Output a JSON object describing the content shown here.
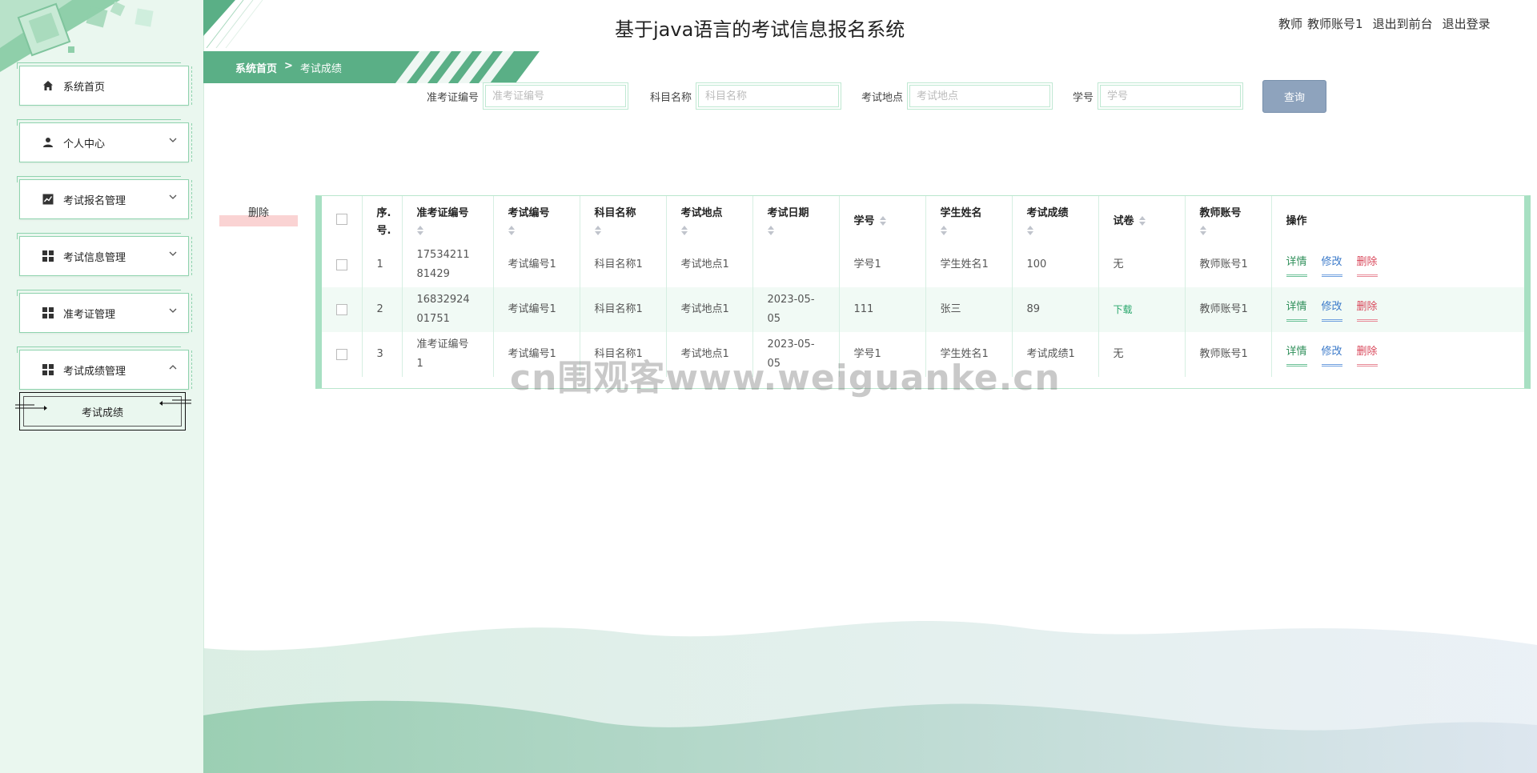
{
  "app": {
    "title": "基于java语言的考试信息报名系统"
  },
  "user_bar": {
    "role": "教师",
    "account": "教师账号1",
    "to_front": "退出到前台",
    "logout": "退出登录"
  },
  "breadcrumb": {
    "home": "系统首页",
    "sep": ">",
    "current": "考试成绩"
  },
  "sidebar": {
    "items": [
      {
        "label": "系统首页",
        "icon": "home-icon"
      },
      {
        "label": "个人中心",
        "icon": "user-icon"
      },
      {
        "label": "考试报名管理",
        "icon": "chart-icon"
      },
      {
        "label": "考试信息管理",
        "icon": "grid-icon"
      },
      {
        "label": "准考证管理",
        "icon": "grid-icon"
      },
      {
        "label": "考试成绩管理",
        "icon": "grid-icon"
      }
    ],
    "submenu_item": "考试成绩"
  },
  "search": {
    "fields": [
      {
        "label": "准考证编号",
        "placeholder": "准考证编号",
        "value": ""
      },
      {
        "label": "科目名称",
        "placeholder": "科目名称",
        "value": ""
      },
      {
        "label": "考试地点",
        "placeholder": "考试地点",
        "value": ""
      },
      {
        "label": "学号",
        "placeholder": "学号",
        "value": ""
      }
    ],
    "button": "查询"
  },
  "toolbar": {
    "delete": "删除"
  },
  "table": {
    "headers": [
      "序.号.",
      "准考证编号",
      "考试编号",
      "科目名称",
      "考试地点",
      "考试日期",
      "学号",
      "学生姓名",
      "考试成绩",
      "试卷",
      "教师账号",
      "操作"
    ],
    "seq_header": [
      "序.",
      "号."
    ],
    "rows": [
      {
        "seq": "1",
        "ticket": [
          "17534211",
          "81429"
        ],
        "exam_no": "考试编号1",
        "subject": "科目名称1",
        "place": "考试地点1",
        "date": [
          "",
          ""
        ],
        "student_no": "学号1",
        "student_name": "学生姓名1",
        "score": "100",
        "paper": "无",
        "teacher": "教师账号1"
      },
      {
        "seq": "2",
        "ticket": [
          "16832924",
          "01751"
        ],
        "exam_no": "考试编号1",
        "subject": "科目名称1",
        "place": "考试地点1",
        "date": [
          "2023-05-",
          "05"
        ],
        "student_no": "111",
        "student_name": "张三",
        "score": "89",
        "paper": "下载",
        "teacher": "教师账号1"
      },
      {
        "seq": "3",
        "ticket": [
          "准考证编号",
          "1"
        ],
        "exam_no": "考试编号1",
        "subject": "科目名称1",
        "place": "考试地点1",
        "date": [
          "2023-05-",
          "05"
        ],
        "student_no": "学号1",
        "student_name": "学生姓名1",
        "score": "考试成绩1",
        "paper": "无",
        "teacher": "教师账号1"
      }
    ],
    "actions": {
      "detail": "详情",
      "edit": "修改",
      "delete": "删除"
    }
  },
  "watermark": "cn围观客www.weiguanke.cn",
  "colors": {
    "primary": "#5aaf86",
    "sidebar_bg": "#eaf7ef",
    "query_button": "#8ea3bd",
    "delete_link": "#d9475a",
    "edit_link": "#3a79c9",
    "detail_link": "#2f8f5a"
  }
}
